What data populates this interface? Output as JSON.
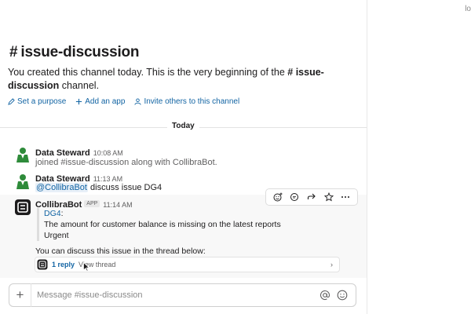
{
  "channel": {
    "hash": "#",
    "name": "issue-discussion",
    "intro_prefix": "You created this channel today. This is the very beginning of the",
    "intro_channel": "# issue-discussion",
    "intro_suffix": "channel."
  },
  "actions": [
    {
      "label": "Set a purpose",
      "icon": "pencil-icon"
    },
    {
      "label": "Add an app",
      "icon": "plus-icon"
    },
    {
      "label": "Invite others to this channel",
      "icon": "person-icon"
    }
  ],
  "divider_label": "Today",
  "messages": [
    {
      "author": "Data Steward",
      "time": "10:08 AM",
      "text": "joined #issue-discussion along with CollibraBot."
    },
    {
      "author": "Data Steward",
      "time": "11:13 AM",
      "mention": "@CollibraBot",
      "text": "discuss issue DG4"
    }
  ],
  "bot_message": {
    "author": "CollibraBot",
    "badge": "APP",
    "time": "11:14 AM",
    "quote_link": "DG4",
    "quote_colon": ":",
    "quote_line1": "The amount for customer balance is missing on the latest reports",
    "quote_line2": "Urgent",
    "footer_text": "You can discuss this issue in the thread below:",
    "reply_count": "1 reply",
    "view_thread": "View thread"
  },
  "toolbar_icons": [
    "add-reaction-icon",
    "reply-in-thread-icon",
    "share-icon",
    "bookmark-icon",
    "more-actions-icon"
  ],
  "composer": {
    "placeholder": "Message #issue-discussion"
  },
  "right_panel": {
    "text": "lo"
  },
  "colors": {
    "link": "#1264a3",
    "avatar_green": "#2e8b3a",
    "bot_dark": "#1d1c1d"
  }
}
